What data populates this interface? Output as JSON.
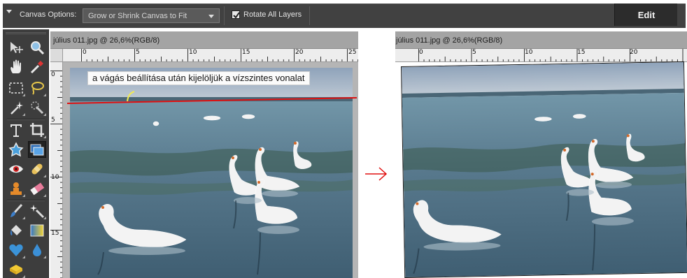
{
  "options_bar": {
    "canvas_options_label": "Canvas Options:",
    "canvas_option_selected": "Grow or Shrink Canvas to Fit",
    "rotate_all_layers_label": "Rotate All Layers",
    "rotate_all_layers_checked": true,
    "mode_button_label": "Edit"
  },
  "toolbox": {
    "tools": [
      "move-tool-icon",
      "zoom-tool-icon",
      "hand-tool-icon",
      "eyedropper-tool-icon",
      "rectangular-marquee-icon",
      "lasso-tool-icon",
      "magic-wand-icon",
      "quick-selection-icon",
      "type-tool-icon",
      "crop-tool-icon",
      "cookie-cutter-icon",
      "straighten-tool-icon",
      "red-eye-icon",
      "spot-healing-icon",
      "clone-stamp-icon",
      "eraser-icon",
      "brush-icon",
      "smart-brush-icon",
      "paint-bucket-icon",
      "gradient-icon",
      "custom-shape-icon",
      "blur-tool-icon",
      "sponge-tool-icon"
    ],
    "selected_tool": "straighten-tool-icon"
  },
  "documents": [
    {
      "tab_title": "július 011.jpg @ 26,6%(RGB/8)",
      "ruler_h_labels": [
        "0",
        "5",
        "10",
        "15",
        "20",
        "25"
      ],
      "ruler_v_labels": [
        "0",
        "5",
        "10",
        "15"
      ]
    },
    {
      "tab_title": "július 011.jpg @ 26,6%(RGB/8)",
      "ruler_h_labels": [
        "0",
        "5",
        "10",
        "15",
        "20"
      ],
      "ruler_v_labels": []
    }
  ],
  "annotation": {
    "text": "a vágás beállítása után kijelöljük a vízszintes vonalat",
    "line_color": "#e01010",
    "arrow_color": "#e01010"
  },
  "colors": {
    "ui_dark": "#414141",
    "canvas_gray": "#b5b5b5",
    "lake_water": "#5e7f93"
  }
}
